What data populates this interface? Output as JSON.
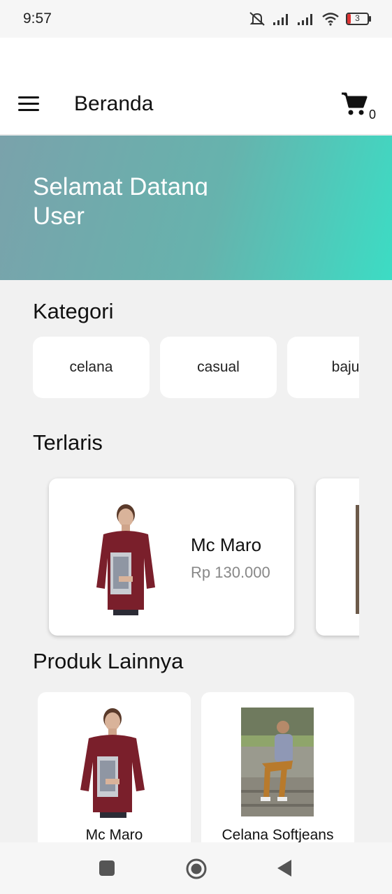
{
  "status_bar": {
    "time": "9:57",
    "battery_level": "3",
    "icons": [
      "mute-icon",
      "signal-icon",
      "signal-icon",
      "wifi-icon",
      "battery-icon"
    ]
  },
  "app_bar": {
    "title": "Beranda",
    "cart_count": "0",
    "icons": [
      "menu-icon",
      "cart-icon"
    ]
  },
  "hero": {
    "line1": "Selamat Datang",
    "line2": "User",
    "colors": [
      "#7aa2ab",
      "#3cdcc4"
    ]
  },
  "kategori": {
    "title": "Kategori",
    "items": [
      {
        "label": "celana"
      },
      {
        "label": "casual"
      },
      {
        "label": "baju"
      }
    ]
  },
  "terlaris": {
    "title": "Terlaris",
    "items": [
      {
        "name": "Mc Maro",
        "price": "Rp 130.000"
      }
    ]
  },
  "produk_lainnya": {
    "title": "Produk Lainnya",
    "items": [
      {
        "name": "Mc Maro"
      },
      {
        "name": "Celana Softjeans"
      }
    ]
  },
  "nav_bar": {
    "icons": [
      "recents-icon",
      "home-icon",
      "back-icon"
    ]
  }
}
